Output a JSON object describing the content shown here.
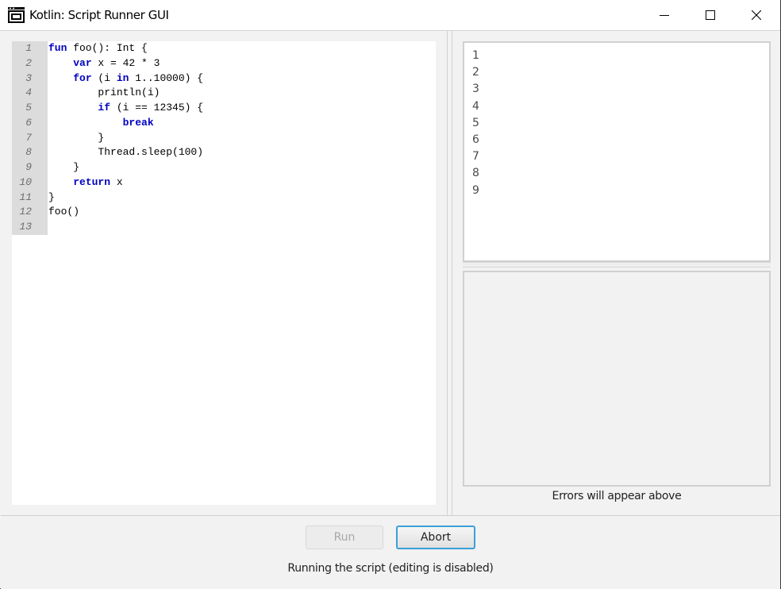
{
  "window": {
    "title": "Kotlin: Script Runner GUI",
    "controls": [
      "minimize",
      "maximize",
      "close"
    ]
  },
  "editor": {
    "line_numbers": [
      "1",
      "2",
      "3",
      "4",
      "5",
      "6",
      "7",
      "8",
      "9",
      "10",
      "11",
      "12",
      "13"
    ],
    "lines": [
      [
        {
          "t": "fun",
          "k": true
        },
        {
          "t": " foo(): Int {"
        }
      ],
      [
        {
          "t": "    "
        },
        {
          "t": "var",
          "k": true
        },
        {
          "t": " x = 42 * 3"
        }
      ],
      [
        {
          "t": "    "
        },
        {
          "t": "for",
          "k": true
        },
        {
          "t": " (i "
        },
        {
          "t": "in",
          "k": true
        },
        {
          "t": " 1..10000) {"
        }
      ],
      [
        {
          "t": "        println(i)"
        }
      ],
      [
        {
          "t": "        "
        },
        {
          "t": "if",
          "k": true
        },
        {
          "t": " (i == 12345) {"
        }
      ],
      [
        {
          "t": "            "
        },
        {
          "t": "break",
          "k": true
        }
      ],
      [
        {
          "t": "        }"
        }
      ],
      [
        {
          "t": "        Thread.sleep(100)"
        }
      ],
      [
        {
          "t": "    }"
        }
      ],
      [
        {
          "t": "    "
        },
        {
          "t": "return",
          "k": true
        },
        {
          "t": " x"
        }
      ],
      [
        {
          "t": "}"
        }
      ],
      [
        {
          "t": "foo()"
        }
      ],
      [
        {
          "t": ""
        }
      ]
    ],
    "keyword_color": "#0000c0"
  },
  "output": {
    "lines": [
      "1",
      "2",
      "3",
      "4",
      "5",
      "6",
      "7",
      "8",
      "9"
    ]
  },
  "errors": {
    "content": "",
    "hint": "Errors will appear above"
  },
  "controls": {
    "run_label": "Run",
    "run_enabled": false,
    "abort_label": "Abort",
    "abort_enabled": true
  },
  "status": "Running the script (editing is disabled)"
}
